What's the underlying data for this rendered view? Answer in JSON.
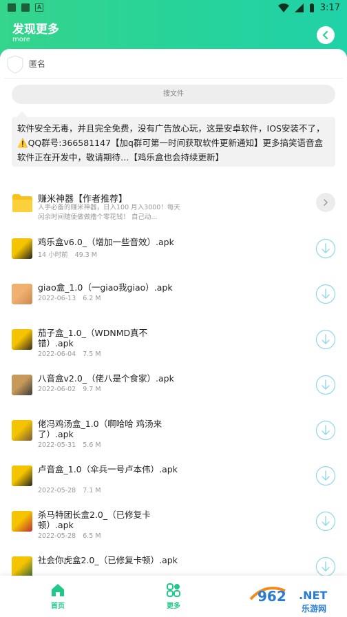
{
  "status_bar": {
    "time": "3:17"
  },
  "header": {
    "title": "发现更多",
    "subtitle": "more",
    "back_icon": "chevron-left-icon"
  },
  "user": {
    "name": "匿名"
  },
  "search": {
    "placeholder": "搜文件"
  },
  "notice": {
    "text": "软件安全无毒，并且完全免费，没有广告放心玩，这是安卓软件，IOS安装不了，⚠️QQ群号:366581147【加q群可第一时间获取软件更新通知】更多搞笑语音盒软件正在开发中，敬请期待…【鸡乐盒也会持续更新】"
  },
  "folder": {
    "title": "赚米神器【作者推荐】",
    "desc": "人手必备的赚米神器，日入100 月入3000！每天闲余时间随便做做撸个零花钱！ 自己动...",
    "icon": "folder-icon"
  },
  "files": [
    {
      "name": "鸡乐盒v6.0_（增加一些音效）.apk",
      "date": "14 小时前",
      "size": "49.3 M"
    },
    {
      "name": "giao盒_1.0（一giao我giao）.apk",
      "date": "2022-06-13",
      "size": "6.2 M"
    },
    {
      "name": "茄子盒_1.0_（WDNMD真不错）.apk",
      "date": "2022-06-04",
      "size": "7.5 M"
    },
    {
      "name": "八音盒v2.0_（佬八是个食家）.apk",
      "date": "2022-06-02",
      "size": "9.7 M"
    },
    {
      "name": "佬冯鸡汤盒_1.0（啊哈哈 鸡汤来了）.apk",
      "date": "2022-05-31",
      "size": "5.6 M"
    },
    {
      "name": "卢音盒_1.0（伞兵一号卢本伟）.apk",
      "date": "2022-05-28",
      "size": "7.1 M"
    },
    {
      "name": "杀马特团长盒2.0_（已修复卡顿）.apk",
      "date": "2022-05-28",
      "size": "6.5 M"
    },
    {
      "name": "社会你虎盒2.0_（已修复卡顿）.apk",
      "date": "",
      "size": ""
    }
  ],
  "nav": {
    "home": "首页",
    "more": "更多"
  },
  "watermark": {
    "brand": "962.NET",
    "sub": "乐游网"
  },
  "colors": {
    "accent": "#20c98a",
    "header_start": "#34d58c",
    "header_end": "#20d2a8"
  }
}
